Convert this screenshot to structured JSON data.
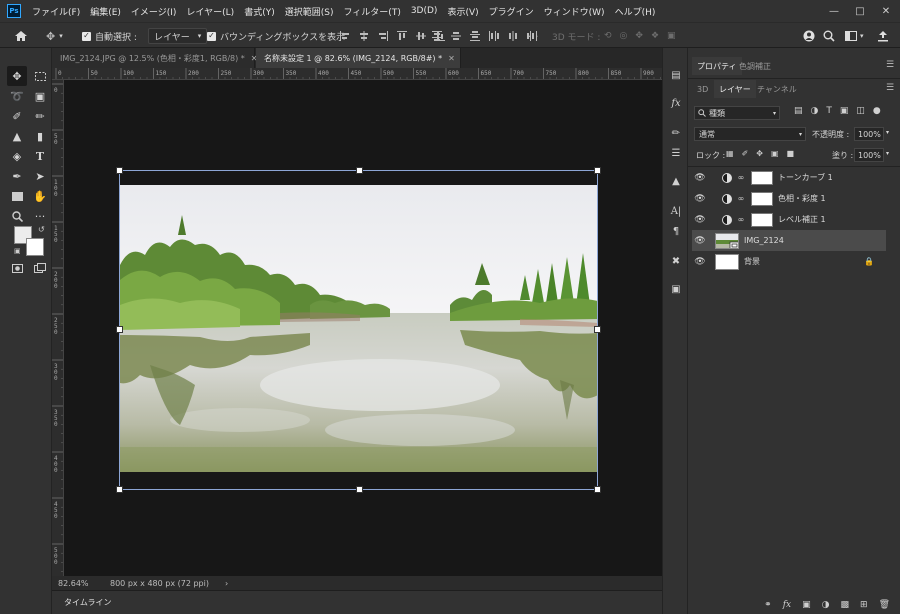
{
  "app": {
    "logo": "Ps"
  },
  "menu": [
    "ファイル(F)",
    "編集(E)",
    "イメージ(I)",
    "レイヤー(L)",
    "書式(Y)",
    "選択範囲(S)",
    "フィルター(T)",
    "3D(D)",
    "表示(V)",
    "プラグイン",
    "ウィンドウ(W)",
    "ヘルプ(H)"
  ],
  "options": {
    "auto_select_label": "自動選択 :",
    "auto_select_target": "レイヤー",
    "bounding_box_label": "バウンディングボックスを表示",
    "mode_3d_label": "3D モード :"
  },
  "tabs": [
    {
      "label": "IMG_2124.JPG @ 12.5% (色相・彩度1, RGB/8) *",
      "active": false
    },
    {
      "label": "名称未設定 1 @ 82.6% (IMG_2124, RGB/8#) *",
      "active": true
    }
  ],
  "rulers": {
    "top": [
      "0",
      "50",
      "100",
      "150",
      "200",
      "250",
      "300",
      "350",
      "400",
      "450",
      "500",
      "550",
      "600",
      "650",
      "700",
      "750",
      "800",
      "850",
      "900"
    ],
    "left": [
      "0",
      "50",
      "100",
      "150",
      "200",
      "250",
      "300",
      "350",
      "400",
      "450",
      "500"
    ]
  },
  "status": {
    "zoom": "82.64%",
    "doc_info": "800 px x 480 px (72 ppi)",
    "arrow": "›"
  },
  "timeline_label": "タイムライン",
  "panel": {
    "top_tabs": [
      "プロパティ",
      "色調補正"
    ],
    "sub_tabs": [
      "3D",
      "レイヤー",
      "チャンネル"
    ],
    "filter_kind": "種類",
    "blend_mode": "通常",
    "opacity_label": "不透明度 :",
    "opacity_value": "100%",
    "lock_label": "ロック :",
    "fill_label": "塗り :",
    "fill_value": "100%"
  },
  "layers": [
    {
      "name": "トーンカーブ 1",
      "type": "adjustment",
      "selected": false
    },
    {
      "name": "色相・彩度 1",
      "type": "adjustment",
      "selected": false
    },
    {
      "name": "レベル補正 1",
      "type": "adjustment",
      "selected": false
    },
    {
      "name": "IMG_2124",
      "type": "smart",
      "selected": true
    },
    {
      "name": "背景",
      "type": "background",
      "selected": false
    }
  ],
  "colors": {
    "accent": "#31a8ff",
    "selected_layer": "#4b4b4b",
    "panel_bg": "#323232",
    "canvas_bg": "#171717"
  }
}
